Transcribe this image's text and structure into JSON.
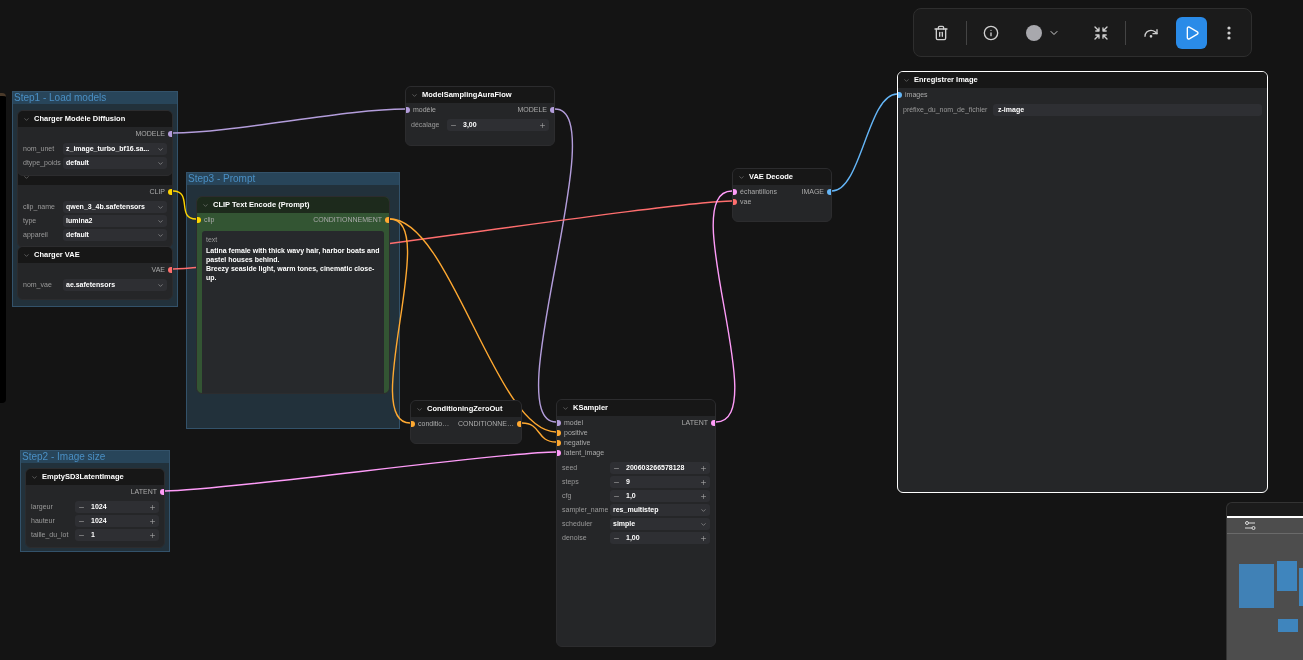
{
  "groups": [
    {
      "title": "Step1 - Load models"
    },
    {
      "title": "Step3 - Prompt"
    },
    {
      "title": "Step2 - Image size"
    }
  ],
  "nodes": [
    {
      "title": "Charger Modèle Diffusion",
      "selected": false,
      "outputs": [
        {
          "label": "MODELE",
          "color": "#b39ddb"
        }
      ],
      "widgets": [
        {
          "kind": "combo",
          "label": "nom_unet",
          "value": "z_image_turbo_bf16.sa..."
        },
        {
          "kind": "combo",
          "label": "dtype_poids",
          "value": "default"
        }
      ]
    },
    {
      "selected": false,
      "outputs": [
        {
          "label": "CLIP",
          "color": "#ffd500"
        }
      ],
      "widgets": [
        {
          "kind": "combo",
          "label": "clip_name",
          "value": "qwen_3_4b.safetensors"
        },
        {
          "kind": "combo",
          "label": "type",
          "value": "lumina2"
        },
        {
          "kind": "combo",
          "label": "appareil",
          "value": "default"
        }
      ]
    },
    {
      "title": "Charger VAE",
      "selected": false,
      "outputs": [
        {
          "label": "VAE",
          "color": "#ff6e6e"
        }
      ],
      "widgets": [
        {
          "kind": "combo",
          "label": "nom_vae",
          "value": "ae.safetensors"
        }
      ]
    },
    {
      "title": "CLIP Text Encode (Prompt)",
      "selected": false,
      "inputs": [
        {
          "label": "clip",
          "color": "#ffd500"
        }
      ],
      "outputs": [
        {
          "label": "CONDITIONNEMENT",
          "color": "#ffa931"
        }
      ],
      "widgets": [
        {
          "kind": "text",
          "label": "text",
          "value": "Latina female with thick wavy hair, harbor boats and pastel houses behind.\nBreezy seaside light, warm tones, cinematic close-up."
        }
      ]
    },
    {
      "title": "ModelSamplingAuraFlow",
      "selected": false,
      "inputs": [
        {
          "label": "modèle",
          "color": "#b39ddb"
        }
      ],
      "outputs": [
        {
          "label": "MODELE",
          "color": "#b39ddb"
        }
      ],
      "widgets": [
        {
          "kind": "number",
          "label": "décalage",
          "value": "3,00"
        }
      ]
    },
    {
      "title": "ConditioningZeroOut",
      "selected": false,
      "inputs": [
        {
          "label": "conditio…",
          "color": "#ffa931"
        }
      ],
      "outputs": [
        {
          "label": "CONDITIONNE…",
          "color": "#ffa931"
        }
      ]
    },
    {
      "title": "KSampler",
      "selected": false,
      "inputs": [
        {
          "label": "model",
          "color": "#b39ddb"
        },
        {
          "label": "positive",
          "color": "#ffa931"
        },
        {
          "label": "negative",
          "color": "#ffa931"
        },
        {
          "label": "latent_image",
          "color": "#ff9cf9"
        }
      ],
      "outputs": [
        {
          "label": "LATENT",
          "color": "#ff9cf9"
        }
      ],
      "widgets": [
        {
          "kind": "number",
          "label": "seed",
          "value": "200603266578128"
        },
        {
          "kind": "number",
          "label": "steps",
          "value": "9"
        },
        {
          "kind": "number",
          "label": "cfg",
          "value": "1,0"
        },
        {
          "kind": "combo",
          "label": "sampler_name",
          "value": "res_multistep"
        },
        {
          "kind": "combo",
          "label": "scheduler",
          "value": "simple"
        },
        {
          "kind": "number",
          "label": "denoise",
          "value": "1,00"
        }
      ]
    },
    {
      "title": "VAE Decode",
      "selected": false,
      "inputs": [
        {
          "label": "échantillons",
          "color": "#ff9cf9"
        },
        {
          "label": "vae",
          "color": "#ff6e6e"
        }
      ],
      "outputs": [
        {
          "label": "IMAGE",
          "color": "#64b5f6"
        }
      ]
    },
    {
      "title": "Enregistrer Image",
      "selected": true,
      "inputs": [
        {
          "label": "images",
          "color": "#64b5f6"
        }
      ],
      "widgets": [
        {
          "kind": "string",
          "label": "préfixe_du_nom_de_fichier",
          "value": "z-image"
        }
      ]
    },
    {
      "title": "EmptySD3LatentImage",
      "selected": false,
      "outputs": [
        {
          "label": "LATENT",
          "color": "#ff9cf9"
        }
      ],
      "widgets": [
        {
          "kind": "number",
          "label": "largeur",
          "value": "1024"
        },
        {
          "kind": "number",
          "label": "hauteur",
          "value": "1024"
        },
        {
          "kind": "number",
          "label": "taille_du_lot",
          "value": "1"
        }
      ]
    }
  ]
}
